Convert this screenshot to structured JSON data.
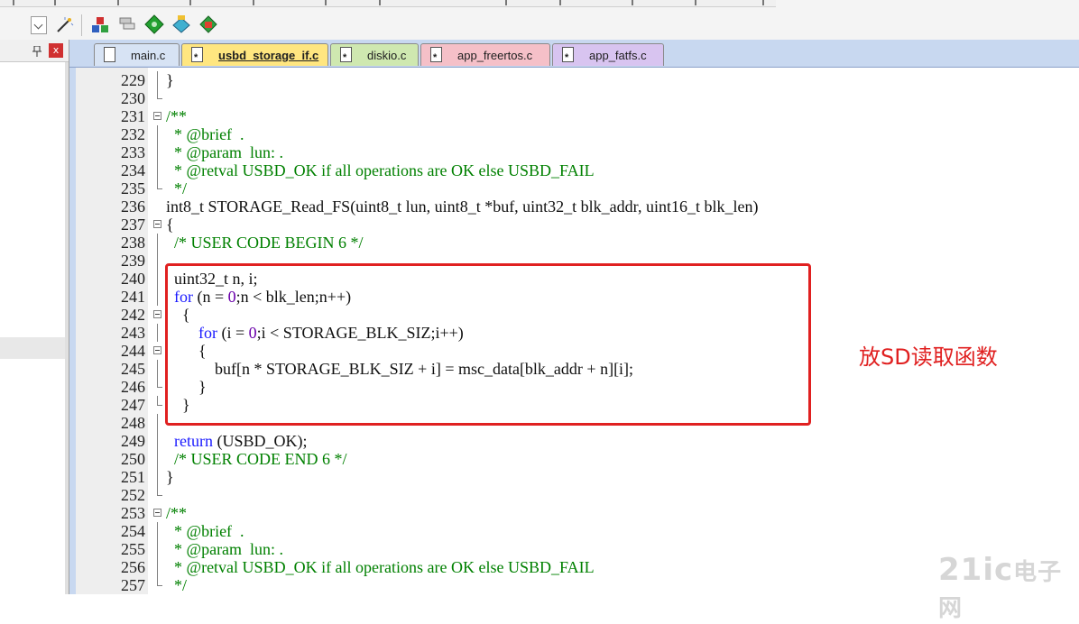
{
  "tabs": [
    {
      "label": "main.c",
      "color": "#d7e3f4",
      "active": false,
      "icon": "file-icon"
    },
    {
      "label": "usbd_storage_if.c",
      "color": "#ffe680",
      "active": true,
      "icon": "c-file-icon"
    },
    {
      "label": "diskio.c",
      "color": "#cfe8b0",
      "active": false,
      "icon": "c-file-icon"
    },
    {
      "label": "app_freertos.c",
      "color": "#f5c0c8",
      "active": false,
      "icon": "c-file-icon"
    },
    {
      "label": "app_fatfs.c",
      "color": "#d8c4f0",
      "active": false,
      "icon": "c-file-icon"
    }
  ],
  "left_panel": {
    "pin_icon": "pin-icon",
    "close_label": "x"
  },
  "code_lines": [
    {
      "n": "229",
      "text": "}",
      "fold": "vline"
    },
    {
      "n": "230",
      "text": "",
      "fold": "end"
    },
    {
      "n": "231",
      "text": "/**",
      "fold": "box"
    },
    {
      "n": "232",
      "text": "  * @brief  .",
      "fold": "vline"
    },
    {
      "n": "233",
      "text": "  * @param  lun: .",
      "fold": "vline"
    },
    {
      "n": "234",
      "text": "  * @retval USBD_OK if all operations are OK else USBD_FAIL",
      "fold": "vline"
    },
    {
      "n": "235",
      "text": "  */",
      "fold": "end"
    },
    {
      "n": "236",
      "text": "int8_t STORAGE_Read_FS(uint8_t lun, uint8_t *buf, uint32_t blk_addr, uint16_t blk_len)",
      "fold": ""
    },
    {
      "n": "237",
      "text": "{",
      "fold": "box"
    },
    {
      "n": "238",
      "text": "  /* USER CODE BEGIN 6 */",
      "fold": "vline"
    },
    {
      "n": "239",
      "text": "",
      "fold": "vline"
    },
    {
      "n": "240",
      "text": "  uint32_t n, i;",
      "fold": "vline"
    },
    {
      "n": "241",
      "text": "  for (n = 0;n < blk_len;n++)",
      "fold": "vline"
    },
    {
      "n": "242",
      "text": "    {",
      "fold": "box"
    },
    {
      "n": "243",
      "text": "        for (i = 0;i < STORAGE_BLK_SIZ;i++)",
      "fold": "vline"
    },
    {
      "n": "244",
      "text": "        {",
      "fold": "box"
    },
    {
      "n": "245",
      "text": "            buf[n * STORAGE_BLK_SIZ + i] = msc_data[blk_addr + n][i];",
      "fold": "vline"
    },
    {
      "n": "246",
      "text": "        }",
      "fold": "end"
    },
    {
      "n": "247",
      "text": "    }",
      "fold": "end"
    },
    {
      "n": "248",
      "text": "",
      "fold": "vline"
    },
    {
      "n": "249",
      "text": "  return (USBD_OK);",
      "fold": "vline"
    },
    {
      "n": "250",
      "text": "  /* USER CODE END 6 */",
      "fold": "vline"
    },
    {
      "n": "251",
      "text": "}",
      "fold": "vline"
    },
    {
      "n": "252",
      "text": "",
      "fold": "end"
    },
    {
      "n": "253",
      "text": "/**",
      "fold": "box"
    },
    {
      "n": "254",
      "text": "  * @brief  .",
      "fold": "vline"
    },
    {
      "n": "255",
      "text": "  * @param  lun: .",
      "fold": "vline"
    },
    {
      "n": "256",
      "text": "  * @retval USBD_OK if all operations are OK else USBD_FAIL",
      "fold": "vline"
    },
    {
      "n": "257",
      "text": "  */",
      "fold": "end"
    }
  ],
  "annotation": {
    "text": "放SD读取函数",
    "color": "#e02020"
  },
  "watermark": {
    "text": "21ic",
    "text_cn": "电子网"
  },
  "colors": {
    "comment": "#008000",
    "keyword": "#1a1aff",
    "number": "#6a00aa",
    "tab_bar": "#c8d8f0"
  }
}
